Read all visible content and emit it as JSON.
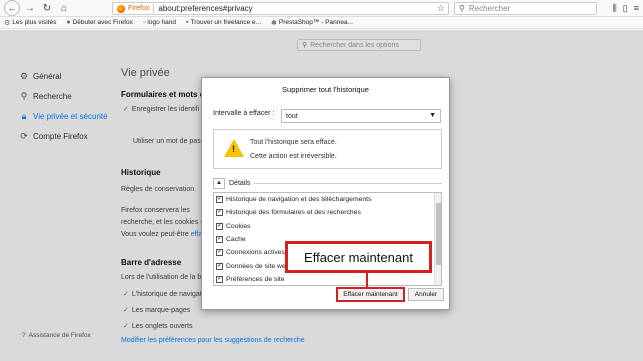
{
  "browser": {
    "firefox_label": "Firefox",
    "url": "about:preferences#privacy",
    "search_placeholder": "Rechercher"
  },
  "bookmarks": [
    {
      "label": "Les plus visités"
    },
    {
      "label": "Débuter avec Firefox"
    },
    {
      "label": "logo hand"
    },
    {
      "label": "Trouver un freelance e..."
    },
    {
      "label": "PrestaShop™ - Pannea..."
    }
  ],
  "prefs_search": {
    "placeholder": "Rechercher dans les options"
  },
  "sidebar": {
    "items": [
      {
        "label": "Général",
        "icon": "gear-icon"
      },
      {
        "label": "Recherche",
        "icon": "search-icon"
      },
      {
        "label": "Vie privée et sécurité",
        "icon": "lock-icon"
      },
      {
        "label": "Compte Firefox",
        "icon": "sync-icon"
      }
    ],
    "footer": "Assistance de Firefox"
  },
  "main": {
    "title": "Vie privée",
    "forms_title": "Formulaires et mots de",
    "save_ids": "Enregistrer les identifi",
    "master_pw": "Utiliser un mot de pass",
    "history_title": "Historique",
    "conservation": "Règles de conservation",
    "history_text1": "Firefox conservera les",
    "history_text2": "recherche, et les cookies d",
    "history_text3": "Vous voulez peut-être ",
    "history_link": "effa",
    "addressbar_title": "Barre d'adresse",
    "addressbar_text": "Lors de l'utilisation de la barre",
    "ab_items": [
      "L'historique de navigati",
      "Les marque-pages",
      "Les onglets ouverts"
    ],
    "suggest_link": "Modifier les préférences pour les suggestions de recherche"
  },
  "dialog": {
    "title": "Supprimer tout l'historique",
    "interval_label": "Intervalle à effacer :",
    "interval_value": "tout",
    "warning_line1": "Tout l'historique sera effacé.",
    "warning_line2": "Cette action est irréversible.",
    "details_label": "Détails",
    "items": [
      {
        "label": "Historique de navigation et des téléchargements",
        "checked": true
      },
      {
        "label": "Historique des formulaires et des recherches",
        "checked": true
      },
      {
        "label": "Cookies",
        "checked": true
      },
      {
        "label": "Cache",
        "checked": true
      },
      {
        "label": "Connexions actives",
        "checked": true
      },
      {
        "label": "Données de site web",
        "checked": true
      },
      {
        "label": "Préférences de site",
        "checked": true
      }
    ],
    "confirm_label": "Effacer maintenant",
    "cancel_label": "Annuler"
  },
  "callout": {
    "label": "Effacer maintenant"
  },
  "colors": {
    "accent": "#0a84ff",
    "highlight": "#d61f1f",
    "warning": "#f5c400"
  }
}
